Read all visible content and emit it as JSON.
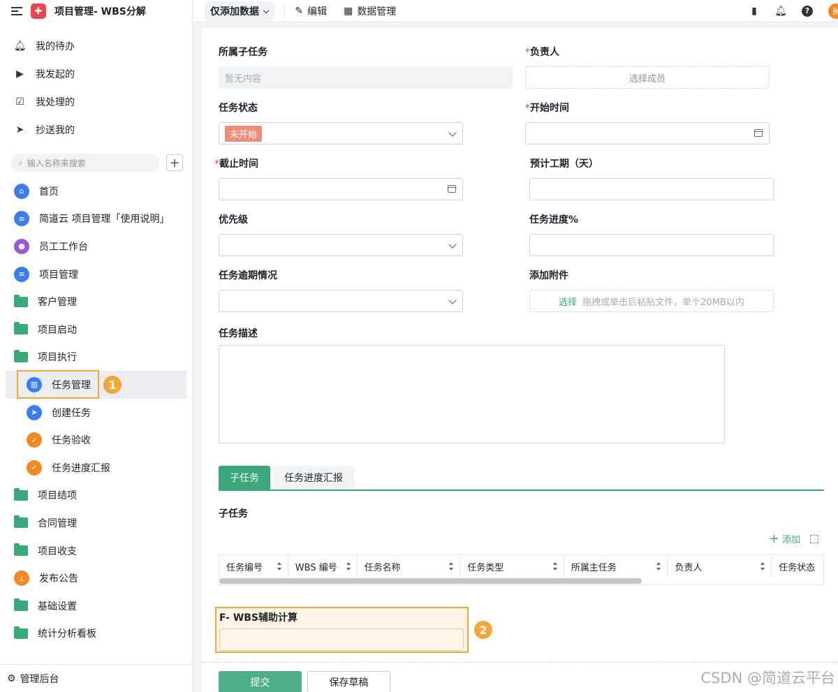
{
  "app": {
    "title": "项目管理- WBS分解",
    "logo_icon": "puzzle-icon"
  },
  "quick_links": [
    {
      "label": "我的待办",
      "icon": "bell-icon"
    },
    {
      "label": "我发起的",
      "icon": "play-circle-icon"
    },
    {
      "label": "我处理的",
      "icon": "inbox-check-icon"
    },
    {
      "label": "抄送我的",
      "icon": "send-icon"
    }
  ],
  "search": {
    "placeholder": "输入名称来搜索"
  },
  "nav": [
    {
      "label": "首页",
      "icon": "home-icon"
    },
    {
      "label": "简道云 项目管理「使用说明」",
      "icon": "document-icon"
    },
    {
      "label": "员工工作台",
      "icon": "user-icon"
    },
    {
      "label": "项目管理",
      "icon": "document-icon"
    },
    {
      "label": "客户管理",
      "icon": "folder-icon"
    },
    {
      "label": "项目启动",
      "icon": "folder-icon"
    },
    {
      "label": "项目执行",
      "icon": "folder-open-icon"
    },
    {
      "label": "任务管理",
      "icon": "chart-icon",
      "active": true
    },
    {
      "label": "创建任务",
      "icon": "send-icon"
    },
    {
      "label": "任务验收",
      "icon": "shield-icon"
    },
    {
      "label": "任务进度汇报",
      "icon": "shield-icon"
    },
    {
      "label": "项目结项",
      "icon": "folder-icon"
    },
    {
      "label": "合同管理",
      "icon": "folder-icon"
    },
    {
      "label": "项目收支",
      "icon": "folder-icon"
    },
    {
      "label": "发布公告",
      "icon": "stamp-icon"
    },
    {
      "label": "基础设置",
      "icon": "folder-icon"
    },
    {
      "label": "统计分析看板",
      "icon": "folder-icon"
    }
  ],
  "annotations": {
    "one": "1",
    "two": "2"
  },
  "admin": {
    "label": "管理后台"
  },
  "toolbar": {
    "view": "仅添加数据",
    "edit": "编辑",
    "data_manage": "数据管理",
    "avatar_text": "张"
  },
  "form": {
    "parent_subtask": {
      "label": "所属子任务",
      "value": "暂无内容"
    },
    "owner": {
      "label": "负责人",
      "placeholder": "选择成员"
    },
    "status": {
      "label": "任务状态",
      "value": "未开始"
    },
    "start_time": {
      "label": "开始时间"
    },
    "deadline": {
      "label": "截止时间"
    },
    "estimated_days": {
      "label": "预计工期（天）"
    },
    "priority": {
      "label": "优先级"
    },
    "progress": {
      "label": "任务进度%"
    },
    "overdue": {
      "label": "任务逾期情况"
    },
    "attachment": {
      "label": "添加附件",
      "link": "选择",
      "hint": "拖拽或单击后粘贴文件，单个20MB以内"
    },
    "description": {
      "label": "任务描述"
    },
    "wbs_calc": {
      "label": "F- WBS辅助计算"
    }
  },
  "tabs": [
    "子任务",
    "任务进度汇报"
  ],
  "subtask_section": {
    "title": "子任务",
    "add_label": "添加",
    "columns": [
      "任务编号",
      "WBS 编号",
      "任务名称",
      "任务类型",
      "所属主任务",
      "负责人",
      "任务状态"
    ]
  },
  "buttons": {
    "submit": "提交",
    "draft": "保存草稿"
  },
  "watermark": "CSDN @简道云平台",
  "colors": {
    "accent": "#3ba87a",
    "highlight": "#f4a637",
    "status_tag": "#f08c7a"
  }
}
